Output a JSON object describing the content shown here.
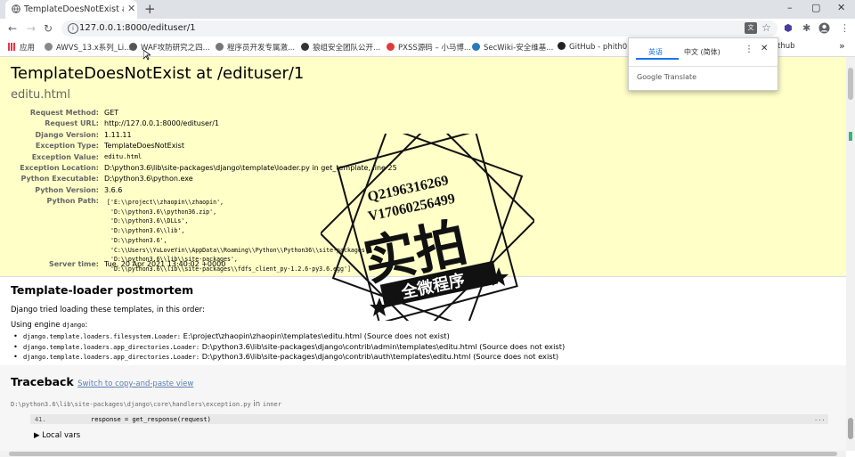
{
  "browser": {
    "tab_title": "TemplateDoesNotExist at /edituser/1",
    "new_tab": "+",
    "window_controls": [
      "–",
      "▢",
      "✕"
    ],
    "url": "127.0.0.1:8000/edituser/1",
    "bookmarks": [
      "应用",
      "AWVS_13.x系列_Li...",
      "WAF攻防研究之四...",
      "程序员开发专属激...",
      "狼组安全团队公开...",
      "PXSS源码 – 小马博...",
      "SecWiki-安全维基...",
      "GitHub - phith0n/"
    ],
    "bookmark_overflow": "thub",
    "more": "»"
  },
  "translate": {
    "lang_active": "英语",
    "lang_other": "中文 (简体)",
    "brand": "Google Translate",
    "accent": "#1a73e8"
  },
  "error": {
    "title": "TemplateDoesNotExist at /edituser/1",
    "subtitle": "editu.html",
    "rows": [
      {
        "k": "Request Method:",
        "v": "GET"
      },
      {
        "k": "Request URL:",
        "v": "http://127.0.0.1:8000/edituser/1"
      },
      {
        "k": "Django Version:",
        "v": "1.11.11"
      },
      {
        "k": "Exception Type:",
        "v": "TemplateDoesNotExist"
      },
      {
        "k": "Exception Value:",
        "v": "editu.html"
      },
      {
        "k": "Exception Location:",
        "v": "D:\\python3.6\\lib\\site-packages\\django\\template\\loader.py in get_template, line 25"
      },
      {
        "k": "Python Executable:",
        "v": "D:\\python3.6\\python.exe"
      },
      {
        "k": "Python Version:",
        "v": "3.6.6"
      },
      {
        "k": "Python Path:",
        "v": ""
      },
      {
        "k": "Server time:",
        "v": "Tue, 20 Apr 2021 13:40:02 +0000"
      }
    ],
    "python_path": "['E:\\\\project\\\\zhaopin\\\\zhaopin',\n 'D:\\\\python3.6\\\\python36.zip',\n 'D:\\\\python3.6\\\\DLLs',\n 'D:\\\\python3.6\\\\lib',\n 'D:\\\\python3.6',\n 'C:\\\\Users\\\\YuLoveYin\\\\AppData\\\\Roaming\\\\Python\\\\Python36\\\\site-packages',\n 'D:\\\\python3.6\\\\lib\\\\site-packages',\n 'D:\\\\python3.6\\\\lib\\\\site-packages\\\\fdfs_client_py-1.2.6-py3.6.egg']",
    "bg": "#ffffc8"
  },
  "postmortem": {
    "heading": "Template-loader postmortem",
    "intro": "Django tried loading these templates, in this order:",
    "engine_prefix": "Using engine",
    "engine": "django",
    "items": [
      {
        "loader": "django.template.loaders.filesystem.Loader:",
        "path": "E:\\project\\zhaopin\\zhaopin\\templates\\editu.html (Source does not exist)"
      },
      {
        "loader": "django.template.loaders.app_directories.Loader:",
        "path": "D:\\python3.6\\lib\\site-packages\\django\\contrib\\admin\\templates\\editu.html (Source does not exist)"
      },
      {
        "loader": "django.template.loaders.app_directories.Loader:",
        "path": "D:\\python3.6\\lib\\site-packages\\django\\contrib\\auth\\templates\\editu.html (Source does not exist)"
      }
    ]
  },
  "traceback": {
    "heading": "Traceback",
    "switch_link": "Switch to copy-and-paste view",
    "file": "D:\\python3.6\\lib\\site-packages\\django\\core\\handlers\\exception.py",
    "in_word": "in",
    "func": "inner",
    "line_no": "41.",
    "code": "response = get_response(request)",
    "ellipsis": "...",
    "local_vars": "Local vars"
  },
  "stamp": {
    "line1": "Q2196316269",
    "line2": "V17060256499",
    "big": "实拍",
    "banner": "全微程序"
  }
}
